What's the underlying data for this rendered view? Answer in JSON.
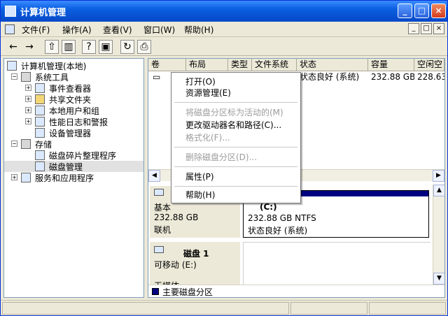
{
  "window": {
    "title": "计算机管理"
  },
  "menubar": {
    "items": [
      "文件(F)",
      "操作(A)",
      "查看(V)",
      "窗口(W)",
      "帮助(H)"
    ],
    "mdi_controls": [
      "_",
      "□",
      "×"
    ]
  },
  "tree": {
    "root": "计算机管理(本地)",
    "system_tools": "系统工具",
    "event_viewer": "事件查看器",
    "shared_folders": "共享文件夹",
    "local_users": "本地用户和组",
    "perf_logs": "性能日志和警报",
    "device_manager": "设备管理器",
    "storage": "存储",
    "defrag": "磁盘碎片整理程序",
    "disk_management": "磁盘管理",
    "services": "服务和应用程序"
  },
  "table": {
    "headers": [
      "卷",
      "布局",
      "类型",
      "文件系统",
      "状态",
      "容量",
      "空闲空"
    ],
    "row": {
      "status": "状态良好 (系统)",
      "capacity": "232.88 GB",
      "free": "228.63"
    }
  },
  "disk0": {
    "type": "基本",
    "size": "232.88 GB",
    "state": "联机",
    "partition_name": "(C:)",
    "partition_size": "232.88 GB NTFS",
    "partition_status": "状态良好 (系统)"
  },
  "disk1": {
    "title": "磁盘 1",
    "type": "可移动 (E:)",
    "media": "无媒体"
  },
  "legend": {
    "primary_partition": "主要磁盘分区"
  },
  "context_menu": {
    "open": "打开(O)",
    "explore": "资源管理(E)",
    "mark_active": "将磁盘分区标为活动的(M)",
    "change_drive": "更改驱动器名和路径(C)...",
    "format": "格式化(F)...",
    "delete": "删除磁盘分区(D)...",
    "properties": "属性(P)",
    "help": "帮助(H)"
  },
  "colors": {
    "titlebar": "#0A5FE0",
    "partition_bar": "#000080"
  }
}
